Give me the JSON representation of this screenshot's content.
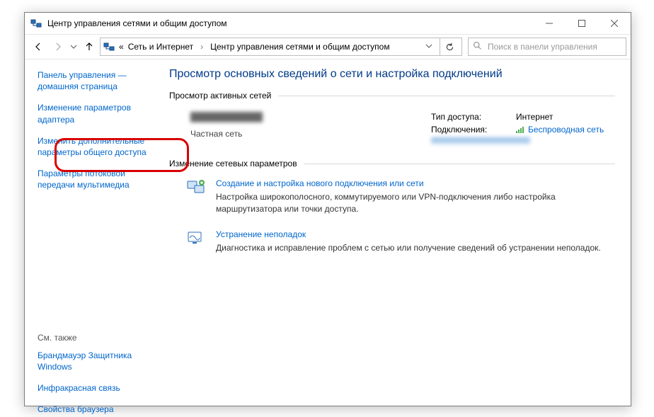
{
  "window": {
    "title": "Центр управления сетями и общим доступом"
  },
  "breadcrumb": {
    "prefix": "«",
    "item1": "Сеть и Интернет",
    "item2": "Центр управления сетями и общим доступом"
  },
  "search": {
    "placeholder": "Поиск в панели управления"
  },
  "sidebar": {
    "link_home": "Панель управления — домашняя страница",
    "link_adapter": "Изменение параметров адаптера",
    "link_sharing": "Изменить дополнительные параметры общего доступа",
    "link_streaming": "Параметры потоковой передачи мультимедиа",
    "see_also": "См. также",
    "link_firewall": "Брандмауэр Защитника Windows",
    "link_infrared": "Инфракрасная связь",
    "link_browser": "Свойства браузера"
  },
  "main": {
    "page_title": "Просмотр основных сведений о сети и настройка подключений",
    "section_active": "Просмотр активных сетей",
    "active_net": {
      "name_blur": "████████████",
      "type": "Частная сеть",
      "access_label": "Тип доступа:",
      "access_value": "Интернет",
      "conn_label": "Подключения:",
      "conn_value": "Беспроводная сеть"
    },
    "section_change": "Изменение сетевых параметров",
    "opt1": {
      "title": "Создание и настройка нового подключения или сети",
      "desc": "Настройка широкополосного, коммутируемого или VPN-подключения либо настройка маршрутизатора или точки доступа."
    },
    "opt2": {
      "title": "Устранение неполадок",
      "desc": "Диагностика и исправление проблем с сетью или получение сведений об устранении неполадок."
    }
  }
}
